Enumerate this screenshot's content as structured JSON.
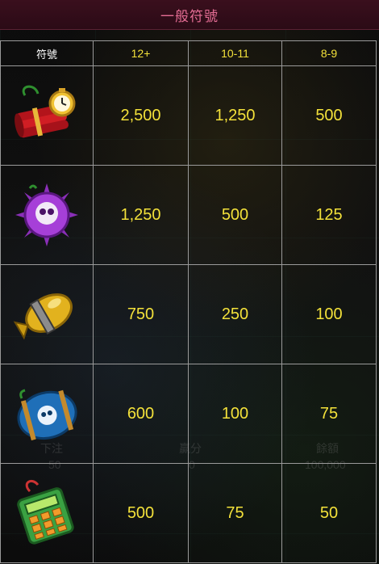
{
  "header": {
    "title": "一般符號"
  },
  "table": {
    "columns": [
      "符號",
      "12+",
      "10-11",
      "8-9"
    ],
    "rows": [
      {
        "icon": "dynamite-bundle-icon",
        "values": [
          "2,500",
          "1,250",
          "500"
        ]
      },
      {
        "icon": "purple-skull-mine-icon",
        "values": [
          "1,250",
          "500",
          "125"
        ]
      },
      {
        "icon": "gold-bomb-icon",
        "values": [
          "750",
          "250",
          "100"
        ]
      },
      {
        "icon": "blue-skull-barrel-icon",
        "values": [
          "600",
          "100",
          "75"
        ]
      },
      {
        "icon": "green-detonator-icon",
        "values": [
          "500",
          "75",
          "50"
        ]
      }
    ]
  },
  "background_labels": {
    "bet_label": "下注",
    "bet_value": "50",
    "win_label": "贏分",
    "win_value": "0",
    "balance_label": "餘額",
    "balance_value": "100,000"
  },
  "colors": {
    "header_bg": "#2b0b16",
    "title": "#e46d94",
    "value": "#f3e13a",
    "grid": "#9a9a9a"
  }
}
